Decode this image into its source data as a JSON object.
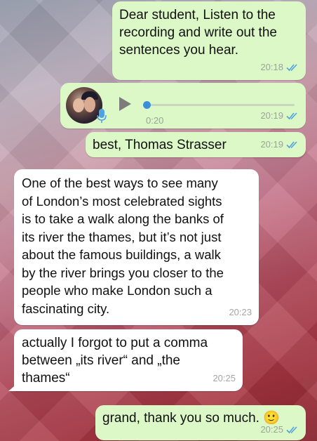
{
  "messages": [
    {
      "direction": "outgoing",
      "text": "Dear student, Listen to the\nrecording and write out the\nsentences you hear.",
      "time": "20:18",
      "status": "read"
    },
    {
      "direction": "outgoing",
      "type": "voice",
      "duration": "0:20",
      "progress": 0,
      "time": "20:19",
      "status": "read"
    },
    {
      "direction": "outgoing",
      "text": "best, Thomas Strasser",
      "time": "20:19",
      "status": "read"
    },
    {
      "direction": "incoming",
      "text": "One of the best ways to see many\nof London’s most celebrated sights\nis to take a walk along the banks of\nits river the thames, but it’s not just\nabout the famous buildings, a walk\nby the river brings you closer to the\npeople who make London such a\nfascinating city.",
      "time": "20:23"
    },
    {
      "direction": "incoming",
      "text": "actually I forgot to put a comma\nbetween „its river“ and „the\nthames“",
      "time": "20:25"
    },
    {
      "direction": "outgoing",
      "text": "grand, thank you so much. 🙂",
      "time": "20:25",
      "status": "read"
    }
  ],
  "colors": {
    "outgoing_bubble": "#dcf8c6",
    "incoming_bubble": "#ffffff",
    "read_ticks": "#4fa3e0",
    "voice_progress": "#3c8ed8"
  },
  "icons": {
    "read_receipt": "double-check-icon",
    "play": "play-icon",
    "microphone": "microphone-icon"
  }
}
